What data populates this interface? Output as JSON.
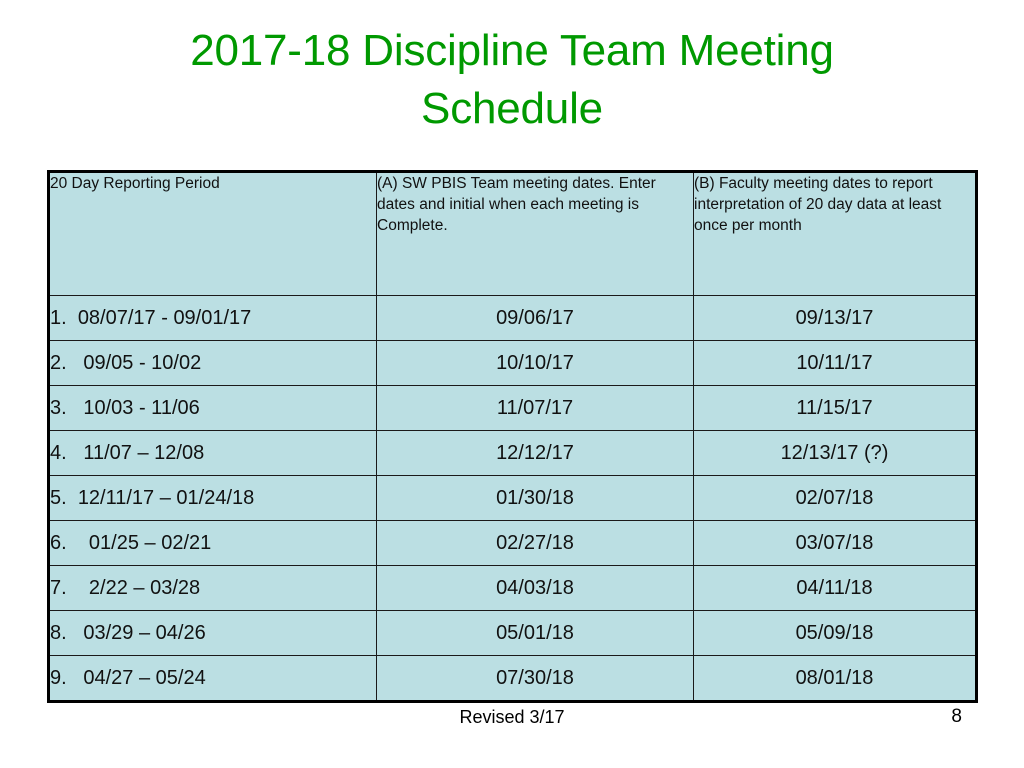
{
  "slide": {
    "title": "2017-18 Discipline Team Meeting\nSchedule",
    "title_color": "#009900",
    "table_fill_color": "#bbdfe3",
    "table_border_color": "#1a1a1a"
  },
  "table": {
    "headers": [
      "20 Day Reporting Period",
      "(A) SW PBIS Team meeting dates. Enter dates and initial when each meeting is Complete.",
      "(B) Faculty meeting dates to report interpretation of 20 day data at least once per month"
    ],
    "rows": [
      {
        "n": "1.",
        "period": "08/07/17 - 09/01/17",
        "indent": "  ",
        "colA": "09/06/17",
        "colB": "09/13/17"
      },
      {
        "n": "2.",
        "period": "09/05 - 10/02",
        "indent": "   ",
        "colA": "10/10/17",
        "colB": "10/11/17"
      },
      {
        "n": "3.",
        "period": "10/03 - 11/06",
        "indent": "   ",
        "colA": "11/07/17",
        "colB": "11/15/17"
      },
      {
        "n": "4.",
        "period": "11/07 – 12/08",
        "indent": "   ",
        "colA": "12/12/17",
        "colB": "12/13/17 (?)"
      },
      {
        "n": "5.",
        "period": "12/11/17 – 01/24/18",
        "indent": "  ",
        "colA": "01/30/18",
        "colB": "02/07/18"
      },
      {
        "n": "6.",
        "period": "01/25 – 02/21",
        "indent": "    ",
        "colA": "02/27/18",
        "colB": "03/07/18"
      },
      {
        "n": "7.",
        "period": "2/22 – 03/28",
        "indent": "    ",
        "colA": "04/03/18",
        "colB": "04/11/18"
      },
      {
        "n": "8.",
        "period": "03/29 – 04/26",
        "indent": "   ",
        "colA": "05/01/18",
        "colB": "05/09/18"
      },
      {
        "n": "9.",
        "period": "04/27 – 05/24",
        "indent": "   ",
        "colA": "07/30/18",
        "colB": "08/01/18"
      }
    ]
  },
  "footer": {
    "note": "Revised 3/17",
    "slide_number": "8"
  }
}
